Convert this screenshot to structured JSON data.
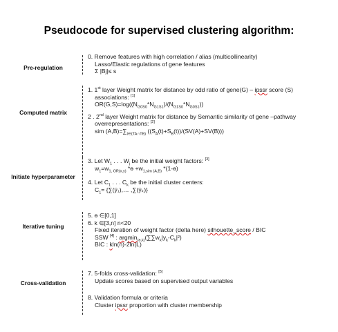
{
  "title": "Pseudocode for supervised clustering algorithm:",
  "sections": {
    "pre_regulation": {
      "label": "Pre-regulation",
      "l1": "0. Remove features with high correlation / alias (multicollinearity)",
      "l2": "Lasso/Elastic regulations of gene features",
      "l3": "Σ |Bj|≤ s"
    },
    "computed_matrix": {
      "label": "Computed matrix",
      "a1_pre": "1. 1",
      "a1_sup": "st",
      "a1_mid": " layer Weight matrix for distance by odd ratio of gene(G) – ",
      "a1_sq": "ipssr",
      "a1_post": " score (S)",
      "a2": "associations:",
      "a2_ref": "[1]",
      "a3_pre": "OR(G,S)=log((N",
      "a3_s1": "G0S0",
      "a3_m1": "*N",
      "a3_s2": "G1S1",
      "a3_m2": ")/(N",
      "a3_s3": "G1S0",
      "a3_m3": "*N",
      "a3_s4": "G0S1",
      "a3_post": "))",
      "b1_pre": "2 . 2",
      "b1_sup": "nd",
      "b1_post": " layer Weight matrix for distance by  Semantic similarity of gene –pathway",
      "b2": "overrepresentations:",
      "b2_ref": "[2]",
      "b3_pre": "sim (A,B)=∑",
      "b3_sub": "t∈(TA∩TB)",
      "b3_m1": " ((S",
      "b3_s1": "A",
      "b3_m2": "(t)+S",
      "b3_s2": "B",
      "b3_post": "(t))/(SV(A)+SV(B)))"
    },
    "initiate_hyperparameter": {
      "label": "Initiate hyperparameter",
      "c1_pre": "3. Let W",
      "c1_s1": "1",
      "c1_mid": " . . . W",
      "c1_s2": "j",
      "c1_post": " be the initial weight factors:",
      "c1_ref": "[3]",
      "c2_pre": "w",
      "c2_s1": "1",
      "c2_m1": "=w",
      "c2_s2": "1, OR(x,y)",
      "c2_m2": " *ɵ +w",
      "c2_s3": "1,sim (A,B)",
      "c2_post": " *(1-ɵ)",
      "d1_pre": "4. Let C",
      "d1_s1": "1",
      "d1_mid": " . . . C",
      "d1_s2": "k",
      "d1_post": " be the initial cluster centers:",
      "d2_pre": "C",
      "d2_s1": "1",
      "d2_post": "= {∑(ȳ₁),… ,∑(ȳₖ)}"
    },
    "iterative_tuning": {
      "label": "Iterative tuning",
      "e1": "5. ɵ ∈[0,1]",
      "e2": "6. k ∈[3,n] n<20",
      "e3_pre": "Fixed iteration of weight factor (delta here) ",
      "e3_sq": "silhouette_score",
      "e3_post": " / BIC",
      "e4_pre": "SSW",
      "e4_ref": "[4]",
      "e4_mid": " : ",
      "e4_sq": "argmin",
      "e4_sub": "(ɵ,k)",
      "e4_post": "(∑∑w",
      "e4_s2": "k",
      "e4_m2": "|y",
      "e4_s3": "k",
      "e4_m3": "-C",
      "e4_s4": "k",
      "e4_end": "|²)",
      "e5_pre": "BIC : ",
      "e5_sq": "k",
      "e5_post": "ln(n)-2ln(L)"
    },
    "cross_validation": {
      "label": "Cross-validation",
      "f1": "7. 5-folds cross-validation:",
      "f1_ref": "[5]",
      "f2": "Update scores based on supervised output variables",
      "g1": "8. Validation formula or criteria",
      "g2_pre": "Cluster ",
      "g2_sq": "ipssr",
      "g2_post": " proportion with cluster membership"
    }
  }
}
